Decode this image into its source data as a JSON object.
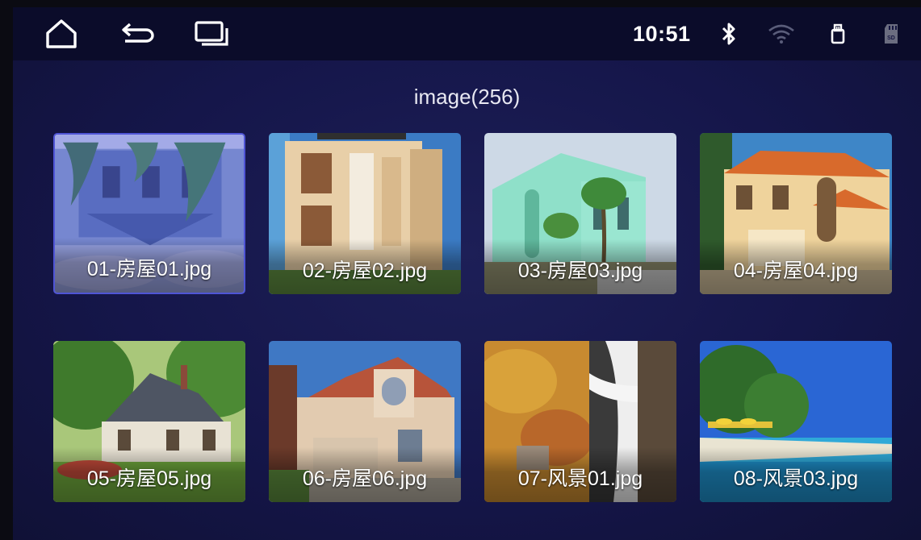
{
  "status_bar": {
    "home_icon": "home-icon",
    "back_icon": "back-arrow-icon",
    "recents_icon": "recent-apps-icon",
    "time": "10:51",
    "bluetooth_icon": "bluetooth-icon",
    "wifi_icon": "wifi-icon",
    "usb_icon": "usb-storage-icon",
    "sd_icon": "sd-card-icon",
    "sd_label": "SD"
  },
  "gallery": {
    "title": "image(256)",
    "items": [
      {
        "name": "01-房屋01.jpg",
        "selected": true
      },
      {
        "name": "02-房屋02.jpg"
      },
      {
        "name": "03-房屋03.jpg"
      },
      {
        "name": "04-房屋04.jpg"
      },
      {
        "name": "05-房屋05.jpg"
      },
      {
        "name": "06-房屋06.jpg"
      },
      {
        "name": "07-风景01.jpg"
      },
      {
        "name": "08-风景03.jpg"
      }
    ]
  },
  "colors": {
    "background": "#141540",
    "status_bar": "#0b0c2a",
    "selection_accent": "#4f55d6"
  }
}
